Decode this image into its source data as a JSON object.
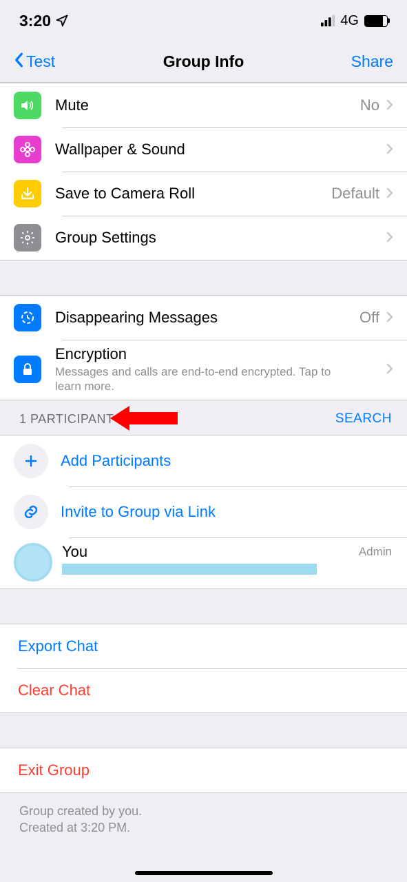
{
  "status": {
    "time": "3:20",
    "network": "4G"
  },
  "nav": {
    "back_label": "Test",
    "title": "Group Info",
    "action_label": "Share"
  },
  "settings_rows": {
    "mute": {
      "label": "Mute",
      "value": "No"
    },
    "wallpaper": {
      "label": "Wallpaper & Sound"
    },
    "camera_roll": {
      "label": "Save to Camera Roll",
      "value": "Default"
    },
    "group_settings": {
      "label": "Group Settings"
    },
    "disappearing": {
      "label": "Disappearing Messages",
      "value": "Off"
    },
    "encryption": {
      "label": "Encryption",
      "sub": "Messages and calls are end-to-end encrypted. Tap to learn more."
    }
  },
  "participants": {
    "header": "1 PARTICIPANT",
    "search_label": "SEARCH",
    "add_label": "Add Participants",
    "invite_label": "Invite to Group via Link",
    "you": {
      "name": "You",
      "role": "Admin"
    }
  },
  "actions": {
    "export": "Export Chat",
    "clear": "Clear Chat",
    "exit": "Exit Group"
  },
  "footer": {
    "line1": "Group created by you.",
    "line2": "Created at 3:20 PM."
  }
}
